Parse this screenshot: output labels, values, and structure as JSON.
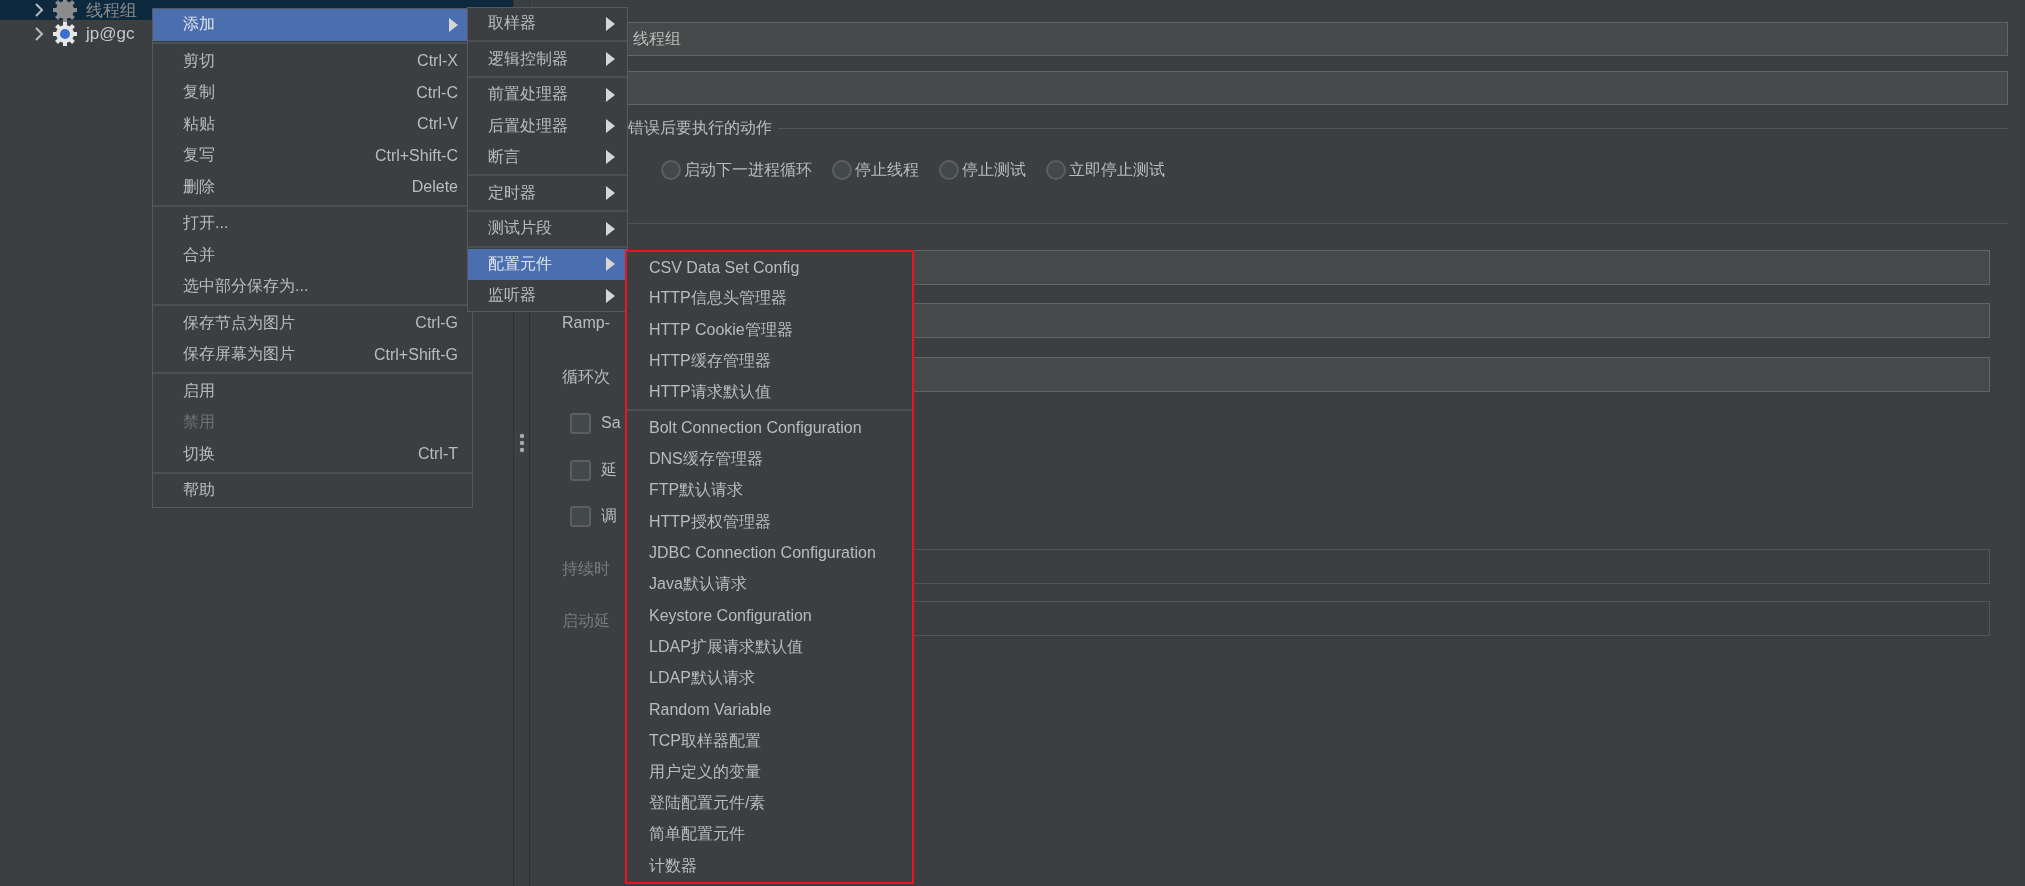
{
  "tree": [
    {
      "label": "线程组",
      "selected": true,
      "disabled": true
    },
    {
      "label": "jp@gc",
      "selected": false,
      "disabled": false
    }
  ],
  "name_field": {
    "value": "线程组"
  },
  "error_action": {
    "legend": "错误后要执行的动作",
    "options": [
      {
        "label": "启动下一进程循环",
        "selected": false
      },
      {
        "label": "停止线程",
        "selected": false
      },
      {
        "label": "停止测试",
        "selected": false
      },
      {
        "label": "立即停止测试",
        "selected": false
      }
    ]
  },
  "rows": [
    {
      "kind": "field",
      "disabled": false
    },
    {
      "kind": "field",
      "label": "Ramp-",
      "disabled": false
    },
    {
      "kind": "field",
      "label": "循环次",
      "disabled": false
    },
    {
      "kind": "checkbox",
      "label": "Sa",
      "checked": false
    },
    {
      "kind": "checkbox",
      "label": "延",
      "checked": false
    },
    {
      "kind": "checkbox",
      "label": "调",
      "checked": false
    },
    {
      "kind": "field",
      "label": "持续时",
      "disabled": true
    },
    {
      "kind": "field",
      "label": "启动延",
      "disabled": true
    }
  ],
  "context_menu": {
    "items": [
      {
        "kind": "submenu",
        "label": "添加",
        "selected": true,
        "disabled": false
      },
      {
        "kind": "separator"
      },
      {
        "kind": "item",
        "label": "剪切",
        "shortcut": "Ctrl-X",
        "selected": false,
        "disabled": false
      },
      {
        "kind": "item",
        "label": "复制",
        "shortcut": "Ctrl-C",
        "selected": false,
        "disabled": false
      },
      {
        "kind": "item",
        "label": "粘贴",
        "shortcut": "Ctrl-V",
        "selected": false,
        "disabled": false
      },
      {
        "kind": "item",
        "label": "复写",
        "shortcut": "Ctrl+Shift-C",
        "selected": false,
        "disabled": false
      },
      {
        "kind": "item",
        "label": "删除",
        "shortcut": "Delete",
        "selected": false,
        "disabled": false
      },
      {
        "kind": "separator"
      },
      {
        "kind": "item",
        "label": "打开...",
        "selected": false,
        "disabled": false
      },
      {
        "kind": "item",
        "label": "合并",
        "selected": false,
        "disabled": false
      },
      {
        "kind": "item",
        "label": "选中部分保存为...",
        "selected": false,
        "disabled": false
      },
      {
        "kind": "separator"
      },
      {
        "kind": "item",
        "label": "保存节点为图片",
        "shortcut": "Ctrl-G",
        "selected": false,
        "disabled": false
      },
      {
        "kind": "item",
        "label": "保存屏幕为图片",
        "shortcut": "Ctrl+Shift-G",
        "selected": false,
        "disabled": false
      },
      {
        "kind": "separator"
      },
      {
        "kind": "item",
        "label": "启用",
        "selected": false,
        "disabled": false
      },
      {
        "kind": "item",
        "label": "禁用",
        "selected": false,
        "disabled": true
      },
      {
        "kind": "item",
        "label": "切换",
        "shortcut": "Ctrl-T",
        "selected": false,
        "disabled": false
      },
      {
        "kind": "separator"
      },
      {
        "kind": "item",
        "label": "帮助",
        "selected": false,
        "disabled": false
      }
    ]
  },
  "add_menu": {
    "items": [
      {
        "kind": "submenu",
        "label": "取样器",
        "selected": false,
        "disabled": false
      },
      {
        "kind": "separator"
      },
      {
        "kind": "submenu",
        "label": "逻辑控制器",
        "selected": false,
        "disabled": false
      },
      {
        "kind": "separator"
      },
      {
        "kind": "submenu",
        "label": "前置处理器",
        "selected": false,
        "disabled": false
      },
      {
        "kind": "submenu",
        "label": "后置处理器",
        "selected": false,
        "disabled": false
      },
      {
        "kind": "submenu",
        "label": "断言",
        "selected": false,
        "disabled": false
      },
      {
        "kind": "separator"
      },
      {
        "kind": "submenu",
        "label": "定时器",
        "selected": false,
        "disabled": false
      },
      {
        "kind": "separator"
      },
      {
        "kind": "submenu",
        "label": "测试片段",
        "selected": false,
        "disabled": false
      },
      {
        "kind": "separator"
      },
      {
        "kind": "submenu",
        "label": "配置元件",
        "selected": true,
        "disabled": false
      },
      {
        "kind": "submenu",
        "label": "监听器",
        "selected": false,
        "disabled": false
      }
    ]
  },
  "config_element_menu": {
    "items": [
      {
        "kind": "item",
        "label": "CSV Data Set Config",
        "selected": false,
        "disabled": false
      },
      {
        "kind": "item",
        "label": "HTTP信息头管理器",
        "selected": false,
        "disabled": false
      },
      {
        "kind": "item",
        "label": "HTTP Cookie管理器",
        "selected": false,
        "disabled": false
      },
      {
        "kind": "item",
        "label": "HTTP缓存管理器",
        "selected": false,
        "disabled": false
      },
      {
        "kind": "item",
        "label": "HTTP请求默认值",
        "selected": false,
        "disabled": false
      },
      {
        "kind": "separator"
      },
      {
        "kind": "item",
        "label": "Bolt Connection Configuration",
        "selected": false,
        "disabled": false
      },
      {
        "kind": "item",
        "label": "DNS缓存管理器",
        "selected": false,
        "disabled": false
      },
      {
        "kind": "item",
        "label": "FTP默认请求",
        "selected": false,
        "disabled": false
      },
      {
        "kind": "item",
        "label": "HTTP授权管理器",
        "selected": false,
        "disabled": false
      },
      {
        "kind": "item",
        "label": "JDBC Connection Configuration",
        "selected": false,
        "disabled": false
      },
      {
        "kind": "item",
        "label": "Java默认请求",
        "selected": false,
        "disabled": false
      },
      {
        "kind": "item",
        "label": "Keystore Configuration",
        "selected": false,
        "disabled": false
      },
      {
        "kind": "item",
        "label": "LDAP扩展请求默认值",
        "selected": false,
        "disabled": false
      },
      {
        "kind": "item",
        "label": "LDAP默认请求",
        "selected": false,
        "disabled": false
      },
      {
        "kind": "item",
        "label": "Random Variable",
        "selected": false,
        "disabled": false
      },
      {
        "kind": "item",
        "label": "TCP取样器配置",
        "selected": false,
        "disabled": false
      },
      {
        "kind": "item",
        "label": "用户定义的变量",
        "selected": false,
        "disabled": false
      },
      {
        "kind": "item",
        "label": "登陆配置元件/素",
        "selected": false,
        "disabled": false
      },
      {
        "kind": "item",
        "label": "简单配置元件",
        "selected": false,
        "disabled": false
      },
      {
        "kind": "item",
        "label": "计数器",
        "selected": false,
        "disabled": false
      }
    ]
  }
}
